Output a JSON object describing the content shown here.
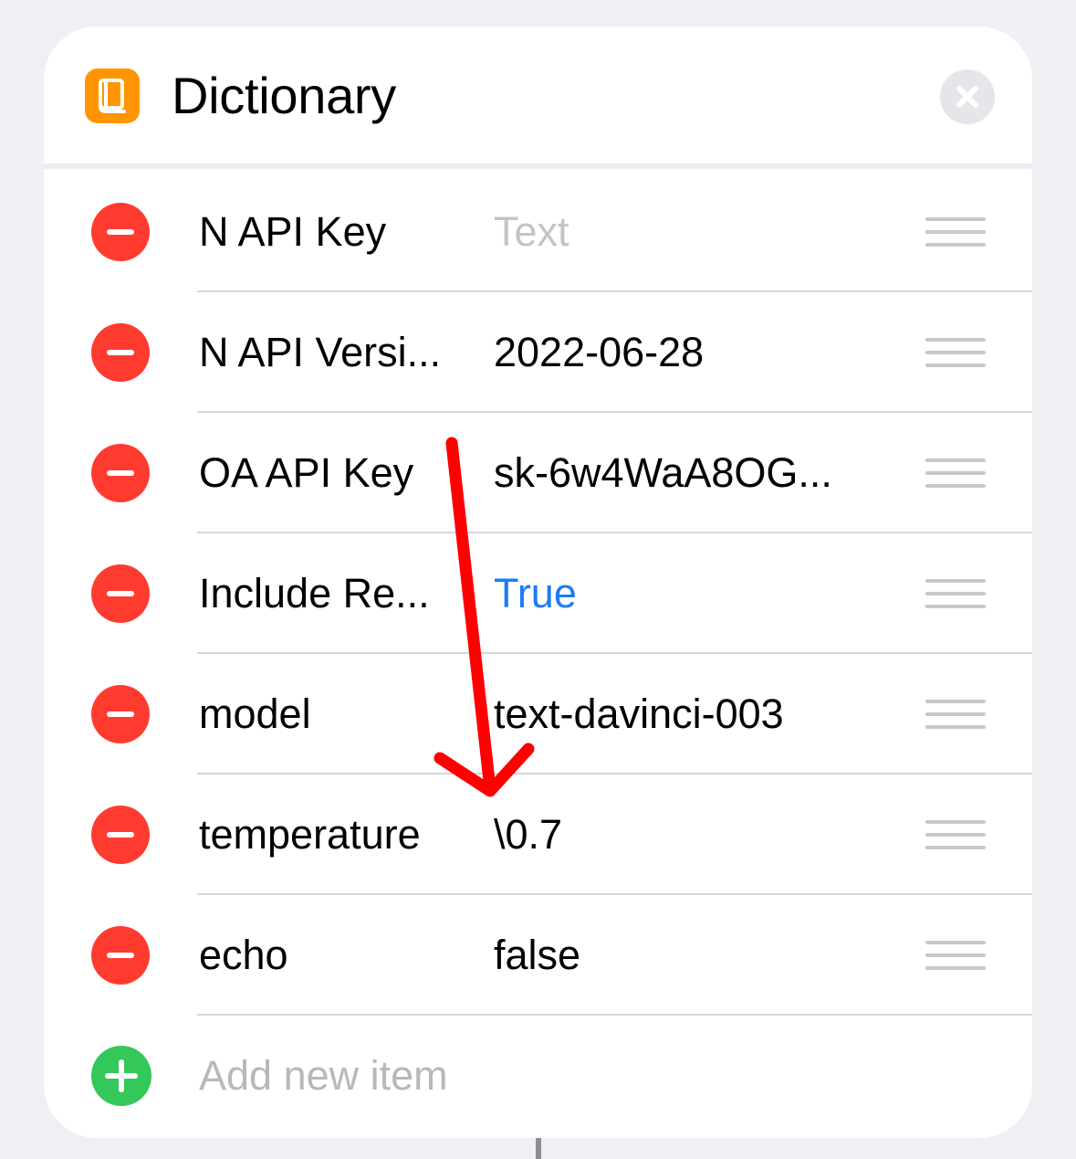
{
  "dialog": {
    "title": "Dictionary",
    "app_icon": "book-icon",
    "close_icon": "close-icon"
  },
  "items": [
    {
      "key": "N API Key",
      "value": "Text",
      "value_style": "placeholder"
    },
    {
      "key": "N API Versi...",
      "value": "2022-06-28",
      "value_style": "normal"
    },
    {
      "key": "OA API Key",
      "value": "sk-6w4WaA8OG...",
      "value_style": "normal"
    },
    {
      "key": "Include Re...",
      "value": "True",
      "value_style": "bool-true"
    },
    {
      "key": "model",
      "value": "text-davinci-003",
      "value_style": "normal"
    },
    {
      "key": "temperature",
      "value": "\\0.7",
      "value_style": "normal"
    },
    {
      "key": "echo",
      "value": "false",
      "value_style": "normal"
    }
  ],
  "add_item": {
    "label": "Add new item"
  },
  "colors": {
    "app_icon": "#ff9500",
    "remove": "#ff3b30",
    "add": "#34c759",
    "bool_true": "#1e7cf2",
    "annotation": "#ff0000"
  }
}
